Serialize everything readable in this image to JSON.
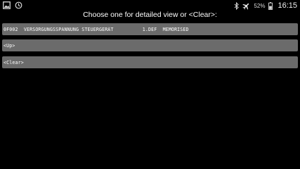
{
  "status_bar": {
    "left_icons": [
      "gallery-icon",
      "sync-icon"
    ],
    "right_icons": [
      "bluetooth-icon",
      "airplane-mode-icon",
      "battery-icon"
    ],
    "battery_percent": "52%",
    "time": "16:15"
  },
  "prompt": "Choose one for detailed view or <Clear>:",
  "list": {
    "items": [
      {
        "label": "0F002  VERSORGUNGSSPANNUNG STEUERGERÄT          1.DEF  MEMORISED"
      },
      {
        "label": "<Up>"
      },
      {
        "label": "<Clear>"
      }
    ]
  },
  "colors": {
    "background": "#000000",
    "item_background": "#6b6b6b",
    "text": "#ffffff"
  }
}
